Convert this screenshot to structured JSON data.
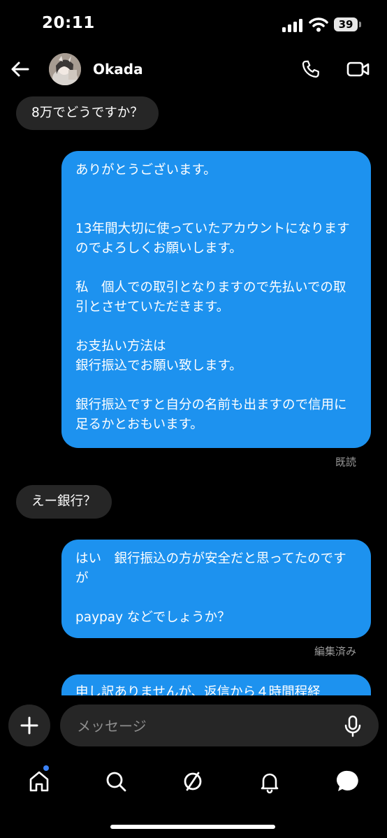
{
  "status_bar": {
    "time": "20:11",
    "battery": "39"
  },
  "header": {
    "contact_name": "Okada",
    "back_icon": "arrow-left-icon",
    "call_icon": "phone-icon",
    "video_icon": "video-camera-icon"
  },
  "messages": [
    {
      "direction": "incoming",
      "text": "8万でどうですか？"
    },
    {
      "direction": "outgoing",
      "text": "ありがとうございます。\n\n\n13年間大切に使っていたアカウントになりますのでよろしくお願いします。\n\n私　個人での取引となりますので先払いでの取引とさせていただきます。\n\nお支払い方法は\n銀行振込でお願い致します。\n\n銀行振込ですと自分の名前も出ますので信用に足るかとおもいます。"
    },
    {
      "direction": "incoming",
      "text": "えー銀行？"
    },
    {
      "direction": "outgoing",
      "text": "はい　銀行振込の方が安全だと思ってたのですが\n\npaypay などでしょうか？"
    },
    {
      "direction": "outgoing",
      "text": "申し訳ありませんが、返信から４時間程経"
    }
  ],
  "read_receipt": "既読",
  "edited_label": "編集済み",
  "composer": {
    "placeholder": "メッセージ",
    "plus_icon": "plus-icon",
    "mic_icon": "microphone-icon"
  },
  "tab_bar": {
    "icons": [
      "home-icon",
      "search-icon",
      "reels-icon",
      "notifications-bell-icon",
      "messages-icon"
    ],
    "accent": "#3b82f6"
  },
  "colors": {
    "outgoing_bubble": "#1d92ef",
    "incoming_bubble": "#262626",
    "background": "#000000"
  }
}
